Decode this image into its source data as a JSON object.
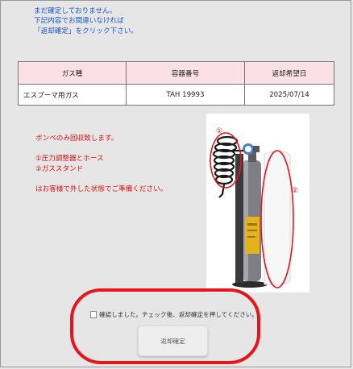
{
  "intro": {
    "line1": "まだ確定しておりません。",
    "line2": "下記内容でお間違いなければ",
    "line3": "「返却確定」をクリック下さい。"
  },
  "table": {
    "headers": [
      "ガス種",
      "容器番号",
      "返却希望日"
    ],
    "rows": [
      [
        "エスプーマ用ガス",
        "TAH 19993",
        "2025/07/14"
      ]
    ]
  },
  "notes": {
    "line1": "ボンベのみ回収致します。",
    "line2": "①圧力調整器とホース",
    "line3": "②ガススタンド",
    "line4": "はお客様で外した状態でご準備ください。"
  },
  "photo": {
    "label1": "①",
    "label2": "②"
  },
  "confirm": {
    "checkbox_label": "確認しました。チェック後、返却確定を押してください。",
    "checked": false
  },
  "button": {
    "label": "返却確定"
  },
  "colors": {
    "intro_text": "#1a55c8",
    "notes_text": "#d11111",
    "header_bg": "#fbe1e7",
    "highlight": "#e8141a"
  }
}
